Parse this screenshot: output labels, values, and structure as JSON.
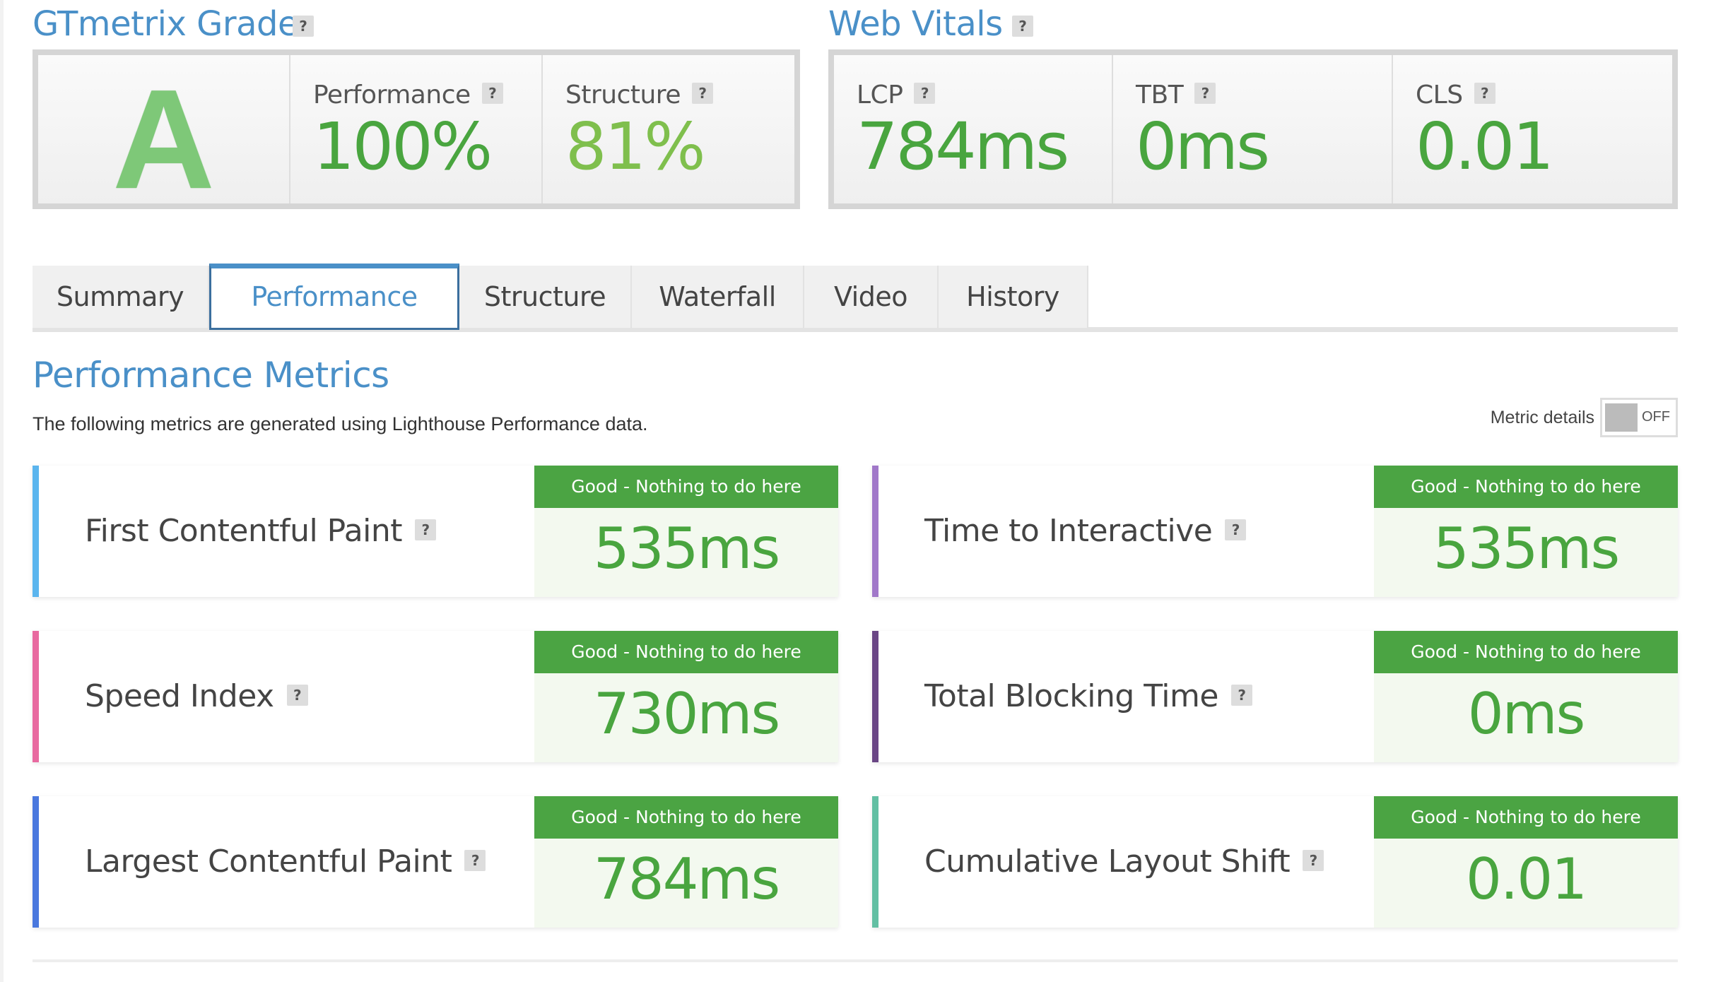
{
  "grade_section": {
    "title": "GTmetrix Grade",
    "grade": "A",
    "performance": {
      "label": "Performance",
      "value": "100%"
    },
    "structure": {
      "label": "Structure",
      "value": "81%"
    }
  },
  "web_vitals": {
    "title": "Web Vitals",
    "lcp": {
      "label": "LCP",
      "value": "784ms"
    },
    "tbt": {
      "label": "TBT",
      "value": "0ms"
    },
    "cls": {
      "label": "CLS",
      "value": "0.01"
    }
  },
  "help_icon_text": "?",
  "tabs": [
    {
      "label": "Summary",
      "active": false
    },
    {
      "label": "Performance",
      "active": true
    },
    {
      "label": "Structure",
      "active": false
    },
    {
      "label": "Waterfall",
      "active": false
    },
    {
      "label": "Video",
      "active": false
    },
    {
      "label": "History",
      "active": false
    }
  ],
  "metrics": {
    "title": "Performance Metrics",
    "description": "The following metrics are generated using Lighthouse Performance data.",
    "toggle": {
      "label": "Metric details",
      "state": "OFF"
    },
    "items": [
      {
        "name": "First Contentful Paint",
        "status": "Good - Nothing to do here",
        "value": "535ms",
        "color": "#5bb5ee"
      },
      {
        "name": "Time to Interactive",
        "status": "Good - Nothing to do here",
        "value": "535ms",
        "color": "#a178c9"
      },
      {
        "name": "Speed Index",
        "status": "Good - Nothing to do here",
        "value": "730ms",
        "color": "#e86aa0"
      },
      {
        "name": "Total Blocking Time",
        "status": "Good - Nothing to do here",
        "value": "0ms",
        "color": "#6a4685"
      },
      {
        "name": "Largest Contentful Paint",
        "status": "Good - Nothing to do here",
        "value": "784ms",
        "color": "#4a78de"
      },
      {
        "name": "Cumulative Layout Shift",
        "status": "Good - Nothing to do here",
        "value": "0.01",
        "color": "#62bfa3"
      }
    ]
  },
  "colors": {
    "accent_blue": "#4a90c8",
    "good_green": "#4ba443",
    "value_green": "#49a53f"
  }
}
